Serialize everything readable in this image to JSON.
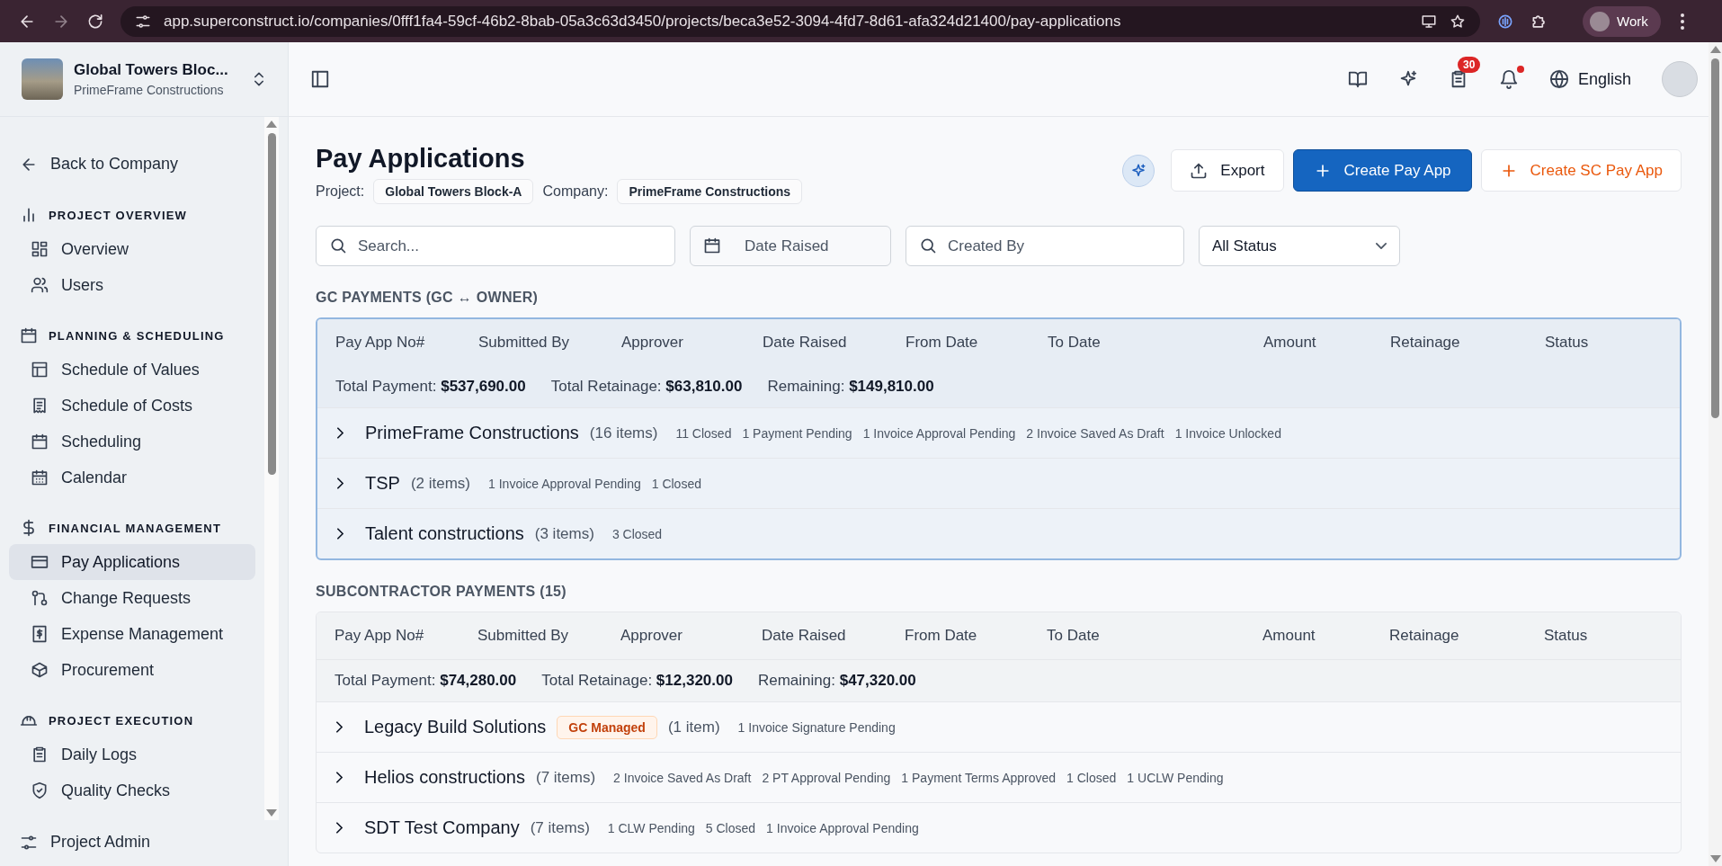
{
  "browser": {
    "url": "app.superconstruct.io/companies/0fff1fa4-59cf-46b2-8bab-05a3c63d3450/projects/beca3e52-3094-4fd7-8d61-afa324d21400/pay-applications",
    "profile": "Work"
  },
  "project_switcher": {
    "name": "Global Towers Bloc...",
    "company": "PrimeFrame Constructions"
  },
  "sidebar": {
    "back": "Back to Company",
    "sections": [
      {
        "title": "PROJECT OVERVIEW",
        "items": [
          {
            "label": "Overview",
            "selected": false
          },
          {
            "label": "Users",
            "selected": false
          }
        ]
      },
      {
        "title": "PLANNING & SCHEDULING",
        "items": [
          {
            "label": "Schedule of Values",
            "selected": false
          },
          {
            "label": "Schedule of Costs",
            "selected": false
          },
          {
            "label": "Scheduling",
            "selected": false
          },
          {
            "label": "Calendar",
            "selected": false
          }
        ]
      },
      {
        "title": "FINANCIAL MANAGEMENT",
        "items": [
          {
            "label": "Pay Applications",
            "selected": true
          },
          {
            "label": "Change Requests",
            "selected": false
          },
          {
            "label": "Expense Management",
            "selected": false
          },
          {
            "label": "Procurement",
            "selected": false
          }
        ]
      },
      {
        "title": "PROJECT EXECUTION",
        "items": [
          {
            "label": "Daily Logs",
            "selected": false
          },
          {
            "label": "Quality Checks",
            "selected": false
          }
        ]
      }
    ],
    "footer": "Project Admin"
  },
  "topbar": {
    "notification_count": "30",
    "language": "English"
  },
  "page": {
    "title": "Pay Applications",
    "project_label": "Project:",
    "project": "Global Towers Block-A",
    "company_label": "Company:",
    "company": "PrimeFrame Constructions"
  },
  "actions": {
    "export": "Export",
    "create": "Create Pay App",
    "create_sc": "Create SC Pay App"
  },
  "filters": {
    "search_placeholder": "Search...",
    "date_placeholder": "Date Raised",
    "created_by_placeholder": "Created By",
    "status": "All Status"
  },
  "tables": [
    {
      "title": "GC PAYMENTS (GC ↔ OWNER)",
      "kind": "gc",
      "columns": [
        "Pay App No#",
        "Submitted By",
        "Approver",
        "Date Raised",
        "From Date",
        "To Date",
        "Amount",
        "Retainage",
        "Status"
      ],
      "totals": [
        {
          "label": "Total Payment:",
          "value": "$537,690.00"
        },
        {
          "label": "Total Retainage:",
          "value": "$63,810.00"
        },
        {
          "label": "Remaining:",
          "value": "$149,810.00"
        }
      ],
      "groups": [
        {
          "name": "PrimeFrame Constructions",
          "count": "(16 items)",
          "statuses": [
            "11 Closed",
            "1 Payment Pending",
            "1 Invoice Approval Pending",
            "2 Invoice Saved As Draft",
            "1 Invoice Unlocked"
          ]
        },
        {
          "name": "TSP",
          "count": "(2 items)",
          "statuses": [
            "1 Invoice Approval Pending",
            "1 Closed"
          ]
        },
        {
          "name": "Talent constructions",
          "count": "(3 items)",
          "statuses": [
            "3 Closed"
          ]
        }
      ]
    },
    {
      "title": "SUBCONTRACTOR PAYMENTS (15)",
      "kind": "sub",
      "columns": [
        "Pay App No#",
        "Submitted By",
        "Approver",
        "Date Raised",
        "From Date",
        "To Date",
        "Amount",
        "Retainage",
        "Status"
      ],
      "totals": [
        {
          "label": "Total Payment:",
          "value": "$74,280.00"
        },
        {
          "label": "Total Retainage:",
          "value": "$12,320.00"
        },
        {
          "label": "Remaining:",
          "value": "$47,320.00"
        }
      ],
      "groups": [
        {
          "name": "Legacy Build Solutions",
          "badge": "GC Managed",
          "count": "(1 item)",
          "statuses": [
            "1 Invoice Signature Pending"
          ]
        },
        {
          "name": "Helios constructions",
          "count": "(7 items)",
          "statuses": [
            "2 Invoice Saved As Draft",
            "2 PT Approval Pending",
            "1 Payment Terms Approved",
            "1 Closed",
            "1 UCLW Pending"
          ]
        },
        {
          "name": "SDT Test Company",
          "count": "(7 items)",
          "statuses": [
            "1 CLW Pending",
            "5 Closed",
            "1 Invoice Approval Pending"
          ]
        }
      ]
    }
  ]
}
